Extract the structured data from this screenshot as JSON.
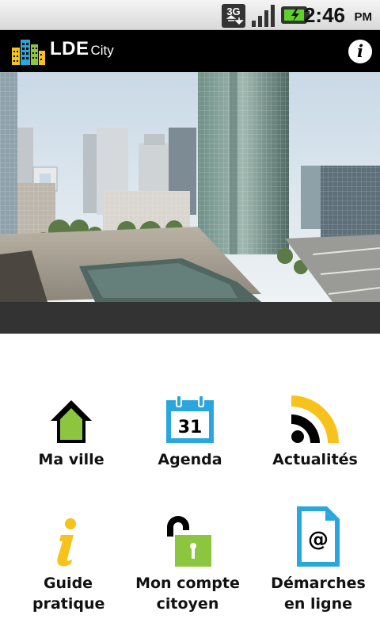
{
  "status": {
    "network": "3G",
    "time": "2:46",
    "ampm": "PM",
    "icons": [
      "3g-data-icon",
      "signal-strength-icon",
      "battery-charging-icon"
    ]
  },
  "header": {
    "brand_main": "LDE",
    "brand_sub": "City",
    "info_glyph": "i"
  },
  "menu": {
    "tiles": [
      {
        "label": "Ma ville",
        "icon": "home-icon"
      },
      {
        "label": "Agenda",
        "icon": "calendar-icon",
        "icon_text": "31"
      },
      {
        "label": "Actualités",
        "icon": "rss-icon"
      },
      {
        "label": "Guide pratique",
        "icon": "info-icon"
      },
      {
        "label": "Mon compte citoyen",
        "icon": "padlock-icon"
      },
      {
        "label": "Démarches en ligne",
        "icon": "document-at-icon",
        "icon_text": "@"
      }
    ]
  },
  "colors": {
    "accent_green": "#8cc63f",
    "accent_yellow": "#f7c21c",
    "accent_blue": "#2aa6df",
    "header_bg": "#000000",
    "caption_bg": "#333333"
  }
}
